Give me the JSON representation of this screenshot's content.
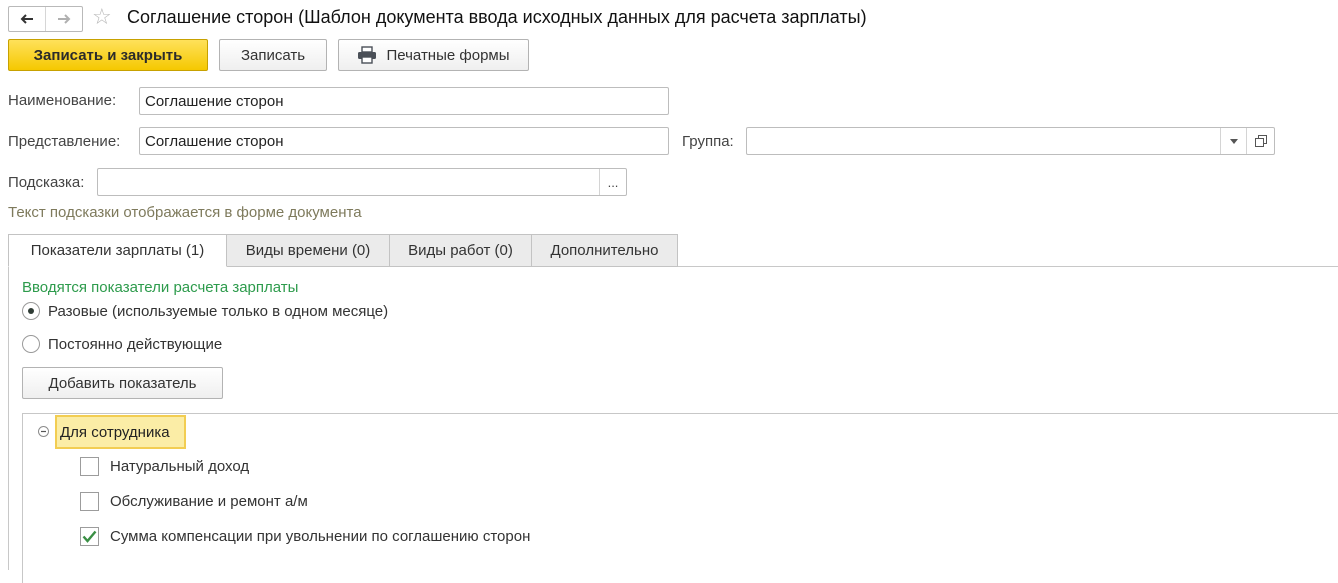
{
  "header": {
    "title": "Соглашение сторон (Шаблон документа ввода исходных данных для расчета зарплаты)",
    "back_icon": "arrow-left-icon",
    "forward_icon": "arrow-right-icon",
    "favorite_icon": "star-icon"
  },
  "toolbar": {
    "save_close_label": "Записать и закрыть",
    "save_label": "Записать",
    "print_label": "Печатные формы",
    "print_icon": "printer-icon"
  },
  "form": {
    "name_label": "Наименование:",
    "name_value": "Соглашение сторон",
    "presentation_label": "Представление:",
    "presentation_value": "Соглашение сторон",
    "group_label": "Группа:",
    "group_value": "",
    "hint_label": "Подсказка:",
    "hint_value": "",
    "hint_button": "...",
    "hint_text": "Текст подсказки отображается в форме документа"
  },
  "tabs": [
    {
      "label": "Показатели зарплаты (1)",
      "active": true
    },
    {
      "label": "Виды времени (0)",
      "active": false
    },
    {
      "label": "Виды работ (0)",
      "active": false
    },
    {
      "label": "Дополнительно",
      "active": false
    }
  ],
  "indicators": {
    "section_title": "Вводятся показатели расчета зарплаты",
    "radio_once": "Разовые (используемые только в одном месяце)",
    "radio_once_selected": true,
    "radio_permanent": "Постоянно действующие",
    "radio_permanent_selected": false,
    "add_button": "Добавить показатель",
    "tree": {
      "group_label": "Для сотрудника",
      "items": [
        {
          "label": "Натуральный доход",
          "checked": false
        },
        {
          "label": "Обслуживание и ремонт а/м",
          "checked": false
        },
        {
          "label": "Сумма компенсации при увольнении по соглашению сторон",
          "checked": true
        }
      ]
    }
  },
  "colors": {
    "primary_button": "#f5c800",
    "section_title": "#2d9b4c",
    "hint_text": "#7e7a5c",
    "check_mark": "#3a8f44",
    "group_highlight": "#fbeda6"
  }
}
